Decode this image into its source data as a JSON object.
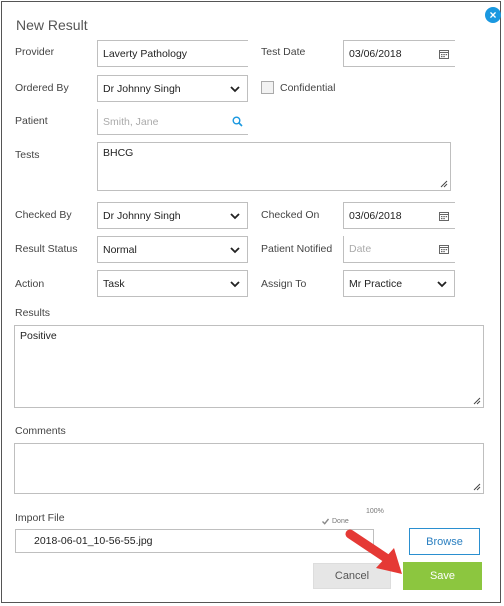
{
  "dialog": {
    "title": "New Result",
    "close_label": "×"
  },
  "labels": {
    "provider": "Provider",
    "test_date": "Test Date",
    "ordered_by": "Ordered By",
    "confidential": "Confidential",
    "patient": "Patient",
    "tests": "Tests",
    "checked_by": "Checked By",
    "checked_on": "Checked On",
    "result_status": "Result Status",
    "patient_notified": "Patient Notified",
    "action": "Action",
    "assign_to": "Assign To",
    "results": "Results",
    "comments": "Comments",
    "import_file": "Import File"
  },
  "fields": {
    "provider": "Laverty Pathology",
    "test_date": "03/06/2018",
    "ordered_by": "Dr Johnny Singh",
    "patient_placeholder": "Smith, Jane",
    "tests": "BHCG",
    "checked_by": "Dr Johnny Singh",
    "checked_on": "03/06/2018",
    "result_status": "Normal",
    "patient_notified_placeholder": "Date",
    "action": "Task",
    "assign_to": "Mr Practice",
    "results": "Positive",
    "comments": "",
    "import_file_name": "2018-06-01_10-56-55.jpg"
  },
  "upload": {
    "progress_label": "100%",
    "progress": 1.0,
    "status": "Done"
  },
  "buttons": {
    "browse": "Browse",
    "cancel": "Cancel",
    "save": "Save"
  },
  "icons": {
    "chevron": "chevron-down-icon",
    "calendar": "calendar-icon",
    "search": "search-icon",
    "close": "close-icon",
    "check": "check-icon",
    "arrow": "red-arrow-icon"
  },
  "colors": {
    "save": "#8cc63f",
    "browse_border": "#2a8fd0",
    "close": "#1a98e0",
    "arrow": "#e53935"
  }
}
